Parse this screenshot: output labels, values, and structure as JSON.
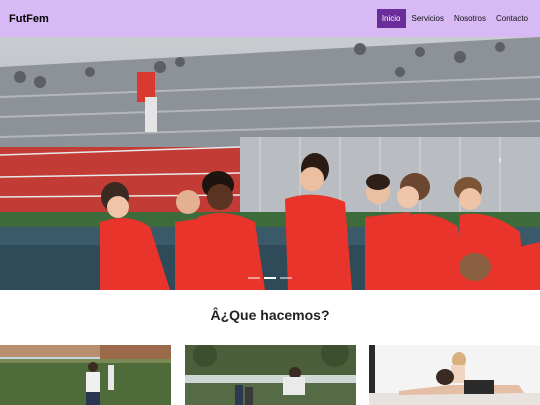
{
  "navbar": {
    "brand": "FutFem",
    "links": [
      {
        "label": "Inicio",
        "active": true
      },
      {
        "label": "Servicios",
        "active": false
      },
      {
        "label": "Nosotros",
        "active": false
      },
      {
        "label": "Contacto",
        "active": false
      }
    ]
  },
  "carousel": {
    "next_icon": "›",
    "slides_count": 3,
    "active_slide": 1
  },
  "section": {
    "title": "Â¿Que hacemos?"
  },
  "colors": {
    "navbar_bg": "#d7b9f5",
    "active_link_bg": "#6a2d9a",
    "jersey_red": "#e8342a"
  }
}
